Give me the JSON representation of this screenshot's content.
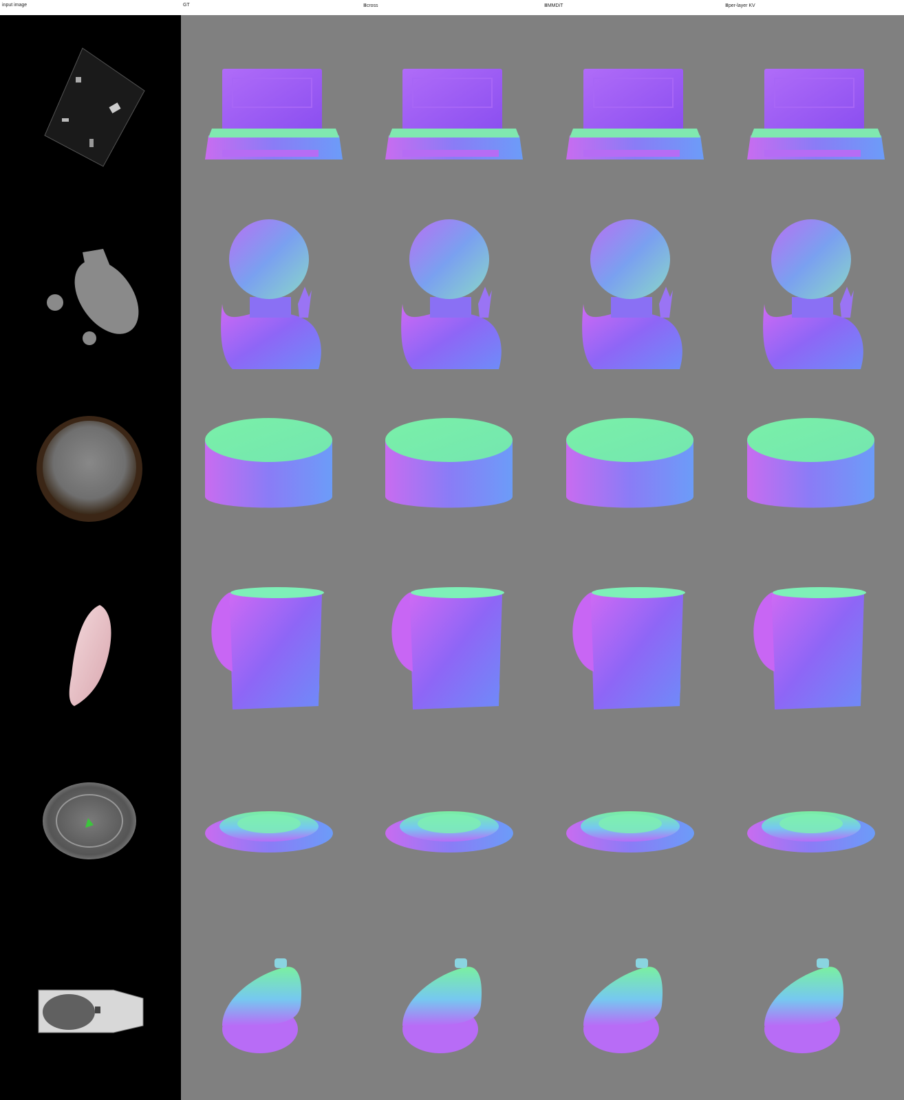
{
  "columns": [
    "input image",
    "GT",
    "Ⅲcross",
    "ⅢMMDiT",
    "Ⅲper-layer KV"
  ],
  "rows": [
    {
      "name": "laptop"
    },
    {
      "name": "bust"
    },
    {
      "name": "cylinder-box"
    },
    {
      "name": "mug"
    },
    {
      "name": "lid"
    },
    {
      "name": "lamp"
    }
  ],
  "colors": {
    "input_bg": "#000000",
    "render_bg": "#808080",
    "normal_purple": "#9b5cf6",
    "normal_green": "#7ef0a0",
    "normal_blue": "#6a8cff",
    "normal_pink": "#e46cf0"
  }
}
